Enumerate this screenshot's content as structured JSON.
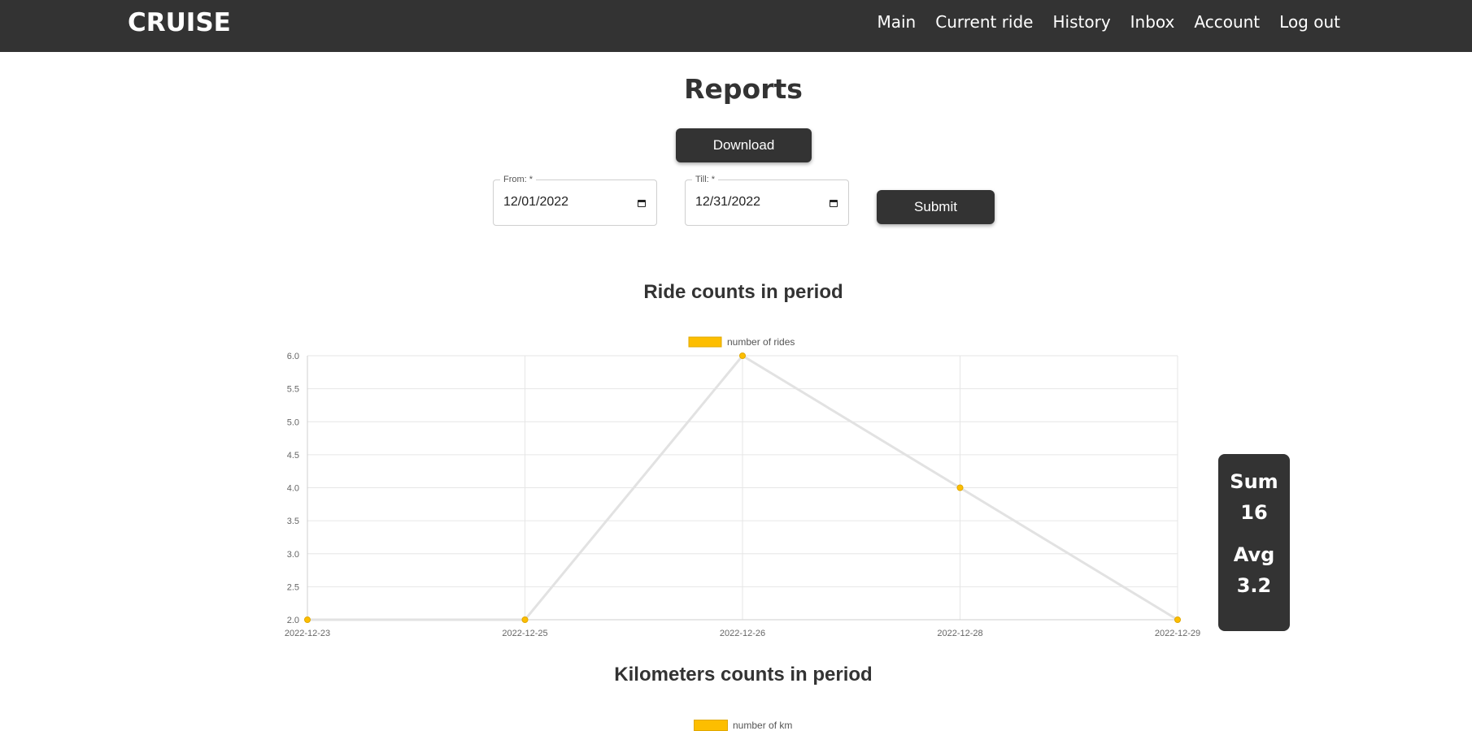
{
  "navbar": {
    "brand": "CRUISE",
    "links": [
      "Main",
      "Current ride",
      "History",
      "Inbox",
      "Account",
      "Log out"
    ]
  },
  "page": {
    "title": "Reports",
    "download_label": "Download",
    "submit_label": "Submit"
  },
  "filters": {
    "from": {
      "label": "From: *",
      "value": "12/01/2022"
    },
    "till": {
      "label": "Till: *",
      "value": "12/31/2022"
    }
  },
  "stats": {
    "sum_label": "Sum",
    "sum_value": "16",
    "avg_label": "Avg",
    "avg_value": "3.2"
  },
  "charts": {
    "rides_title": "Ride counts in period",
    "km_title": "Kilometers counts in period",
    "km_legend": "number of km"
  },
  "colors": {
    "accent": "#FDBE00",
    "dark": "#333333",
    "line": "#E2E2E2"
  },
  "chart_data": [
    {
      "type": "line",
      "title": "Ride counts in period",
      "x": [
        "2022-12-23",
        "2022-12-25",
        "2022-12-26",
        "2022-12-28",
        "2022-12-29"
      ],
      "series": [
        {
          "name": "number of rides",
          "values": [
            2,
            2,
            6,
            4,
            2
          ]
        }
      ],
      "xlabel": "",
      "ylabel": "",
      "ylim": [
        2.0,
        6.0
      ],
      "yticks": [
        "2.0",
        "2.5",
        "3.0",
        "3.5",
        "4.0",
        "4.5",
        "5.0",
        "5.5",
        "6.0"
      ],
      "grid": true,
      "legend": "top-center"
    }
  ]
}
